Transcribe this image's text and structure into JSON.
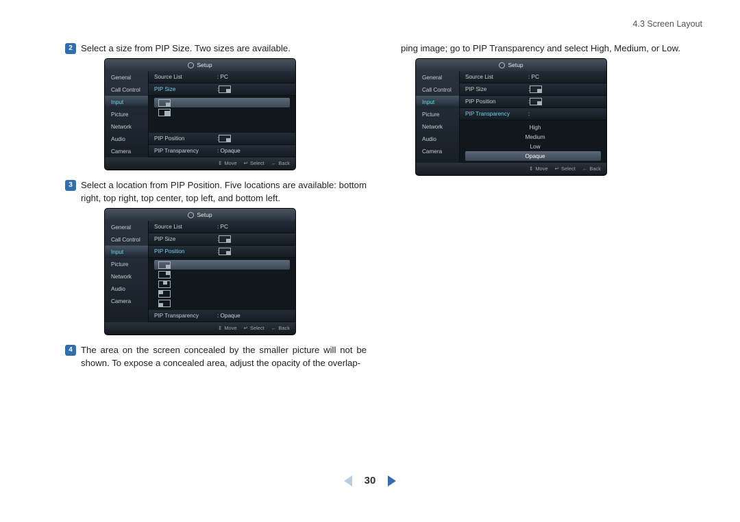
{
  "header": {
    "section": "4.3 Screen Layout"
  },
  "steps": {
    "s2": "Select a size from PIP Size. Two sizes are available.",
    "s3": "Select a location from PIP Position. Five locations are available: bottom right, top right, top center, top left, and bottom left.",
    "s4": "The area on the screen concealed by the smaller picture will not be shown. To expose a concealed area, adjust the opacity of the overlap-",
    "s4cont": "ping image; go to PIP Transparency and select High, Medium, or Low."
  },
  "badges": {
    "n2": "2",
    "n3": "3",
    "n4": "4"
  },
  "osd": {
    "title": "Setup",
    "sidebar": [
      "General",
      "Call Control",
      "Input",
      "Picture",
      "Network",
      "Audio",
      "Camera"
    ],
    "rows": {
      "source": {
        "label": "Source List",
        "value": ": PC"
      },
      "size": {
        "label": "PIP Size",
        "value": ":"
      },
      "pos": {
        "label": "PIP Position",
        "value": ":"
      },
      "trans": {
        "label": "PIP Transparency",
        "value": ": Opaque"
      },
      "trans2": {
        "label": "PIP Transparency",
        "value": ":"
      }
    },
    "transOptions": [
      "High",
      "Medium",
      "Low",
      "Opaque"
    ],
    "foot": {
      "move": "Move",
      "select": "Select",
      "back": "Back"
    }
  },
  "page": {
    "num": "30"
  }
}
